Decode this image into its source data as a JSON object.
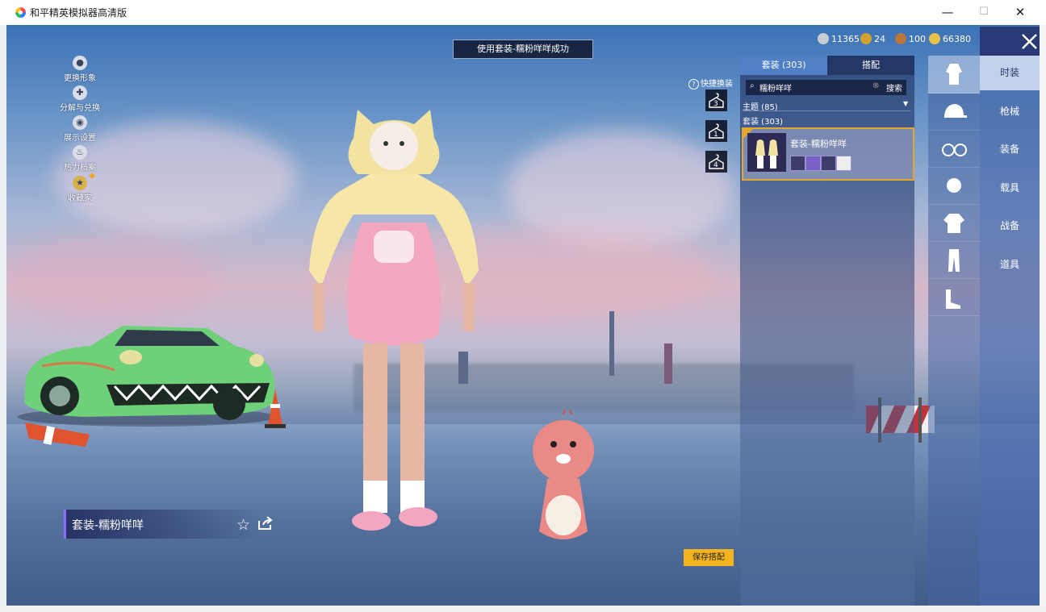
{
  "window": {
    "title": "和平精英模拟器高清版",
    "min_glyph": "—",
    "max_glyph": "☐",
    "close_glyph": "✕"
  },
  "toast": "使用套装-糯粉咩咩成功",
  "left_menu": [
    {
      "label": "更换形象",
      "icon": "person-icon"
    },
    {
      "label": "分解与兑换",
      "icon": "puzzle-icon"
    },
    {
      "label": "展示设置",
      "icon": "eye-icon"
    },
    {
      "label": "热力档案",
      "icon": "flame-icon"
    },
    {
      "label": "收藏家",
      "icon": "collector-badge-icon"
    }
  ],
  "outfit_name": "套装-糯粉咩咩",
  "quick_change": {
    "label": "快捷换装",
    "help": "?",
    "slots": [
      "3",
      "1",
      "4"
    ]
  },
  "save_button": "保存搭配",
  "currencies": [
    {
      "icon": "silver-coin-icon",
      "value": "11365",
      "color": "#c9cdd6"
    },
    {
      "icon": "gold-medal-icon",
      "value": "24",
      "color": "#d1a132"
    },
    {
      "icon": "bronze-coin-icon",
      "value": "100",
      "color": "#b9753b"
    },
    {
      "icon": "gold-coin-icon",
      "value": "66380",
      "color": "#e8c24a"
    }
  ],
  "panel": {
    "tabs": [
      {
        "label": "套装 (303)",
        "active": true
      },
      {
        "label": "搭配",
        "active": false
      }
    ],
    "search": {
      "value": "糯粉咩咩",
      "button": "搜索"
    },
    "theme_section": "主题 (85)",
    "suits_section": "套装 (303)",
    "items": [
      {
        "name": "套装-糯粉咩咩",
        "selected": true
      }
    ]
  },
  "slot_icons": [
    "outfit-icon",
    "hat-icon",
    "glasses-icon",
    "face-icon",
    "top-icon",
    "pants-icon",
    "shoes-icon"
  ],
  "categories": [
    {
      "label": "时装",
      "active": true
    },
    {
      "label": "枪械",
      "active": false
    },
    {
      "label": "装备",
      "active": false
    },
    {
      "label": "载具",
      "active": false
    },
    {
      "label": "战备",
      "active": false
    },
    {
      "label": "道具",
      "active": false
    }
  ],
  "colors": {
    "accent_gold": "#f5b41e",
    "panel_navy": "#2a3a77",
    "name_bar_purple": "#8f6bff"
  }
}
